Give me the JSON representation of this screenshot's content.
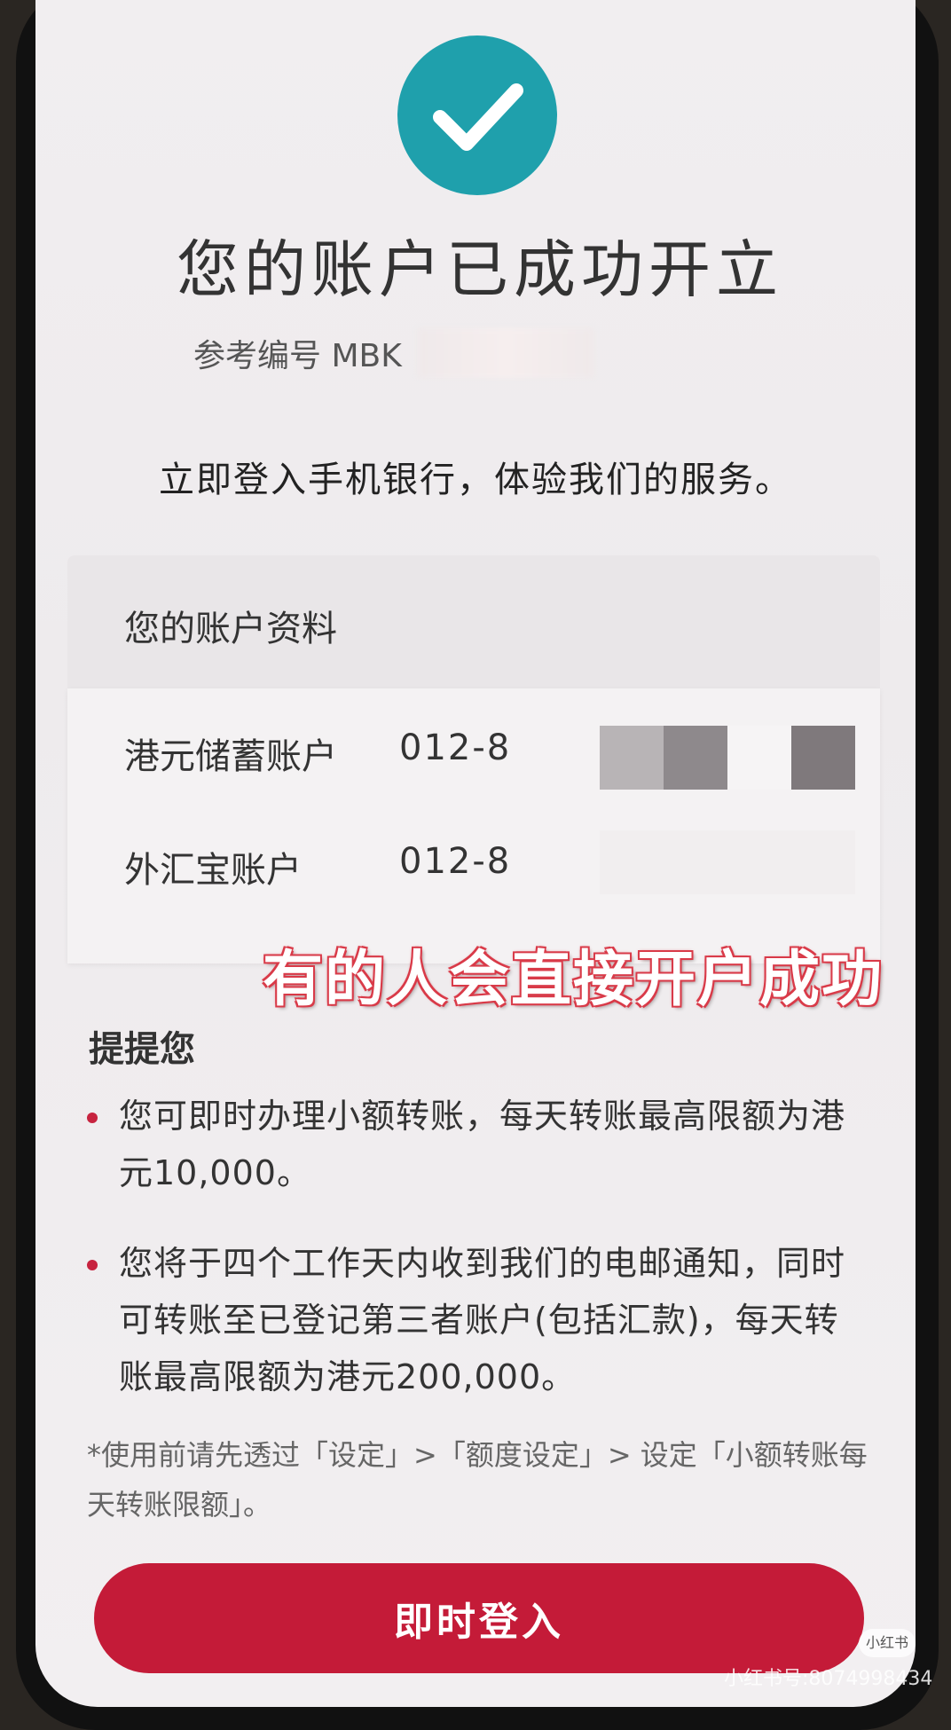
{
  "header": {
    "icon": "check-icon",
    "title": "您的账户已成功开立",
    "reference": "参考编号 MBK"
  },
  "intro": "立即登入手机银行，体验我们的服务。",
  "account_info": {
    "heading": "您的账户资料",
    "rows": [
      {
        "label": "港元储蓄账户",
        "value": "012-8"
      },
      {
        "label": "外汇宝账户",
        "value": "012-8"
      }
    ]
  },
  "overlay_caption": "有的人会直接开户成功",
  "reminder": {
    "title": "提提您",
    "items": [
      "您可即时办理小额转账，每天转账最高限额为港元10,000。",
      "您将于四个工作天内收到我们的电邮通知，同时可转账至已登记第三者账户(包括汇款)，每天转账最高限额为港元200,000。"
    ],
    "note": "*使用前请先透过「设定」>「额度设定」> 设定「小额转账每天转账限额」。"
  },
  "login_button": "即时登入",
  "watermark": {
    "logo": "小红书",
    "text": "小红书号:8074998434"
  },
  "colors": {
    "accent_teal": "#1fa0ac",
    "brand_red": "#c41b38"
  }
}
